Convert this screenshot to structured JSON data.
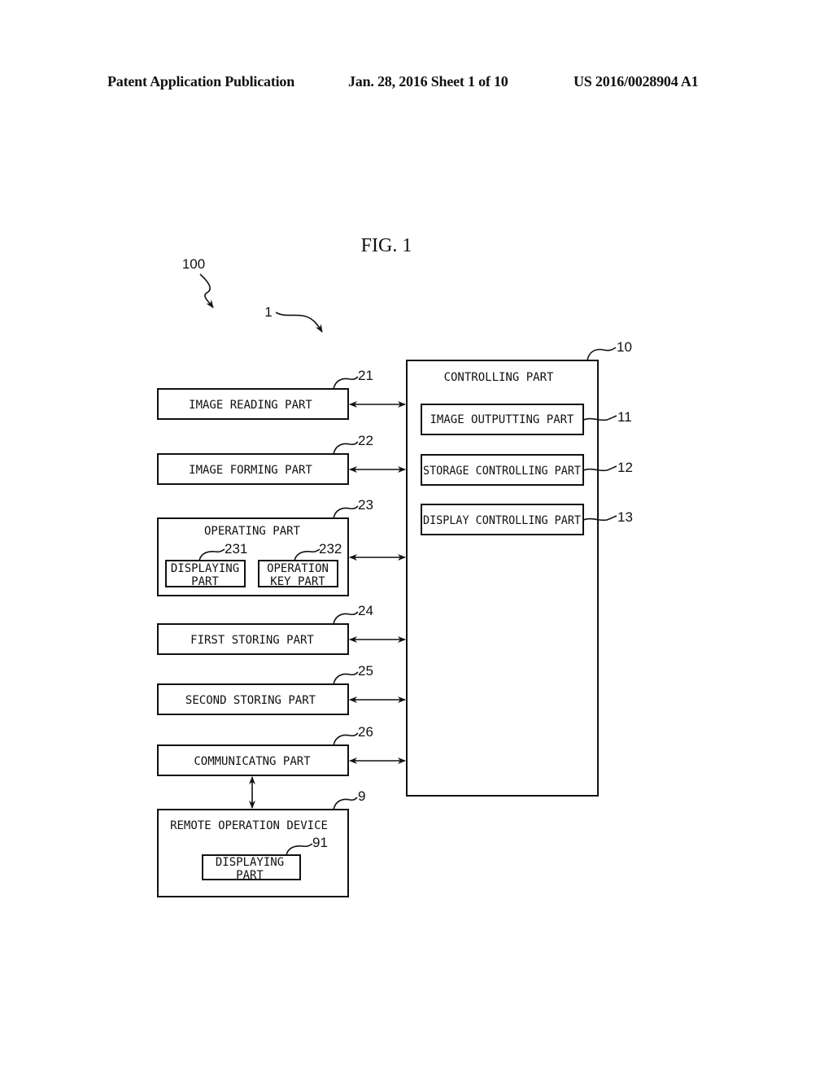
{
  "header": {
    "publication": "Patent Application Publication",
    "date_sheet": "Jan. 28, 2016  Sheet 1 of 10",
    "number": "US 2016/0028904 A1"
  },
  "figure": {
    "title": "FIG. 1",
    "system_ref": "100",
    "apparatus_ref": "1",
    "controller": {
      "ref": "10",
      "label": "CONTROLLING PART",
      "subparts": [
        {
          "ref": "11",
          "label": "IMAGE OUTPUTTING PART"
        },
        {
          "ref": "12",
          "label": "STORAGE CONTROLLING PART"
        },
        {
          "ref": "13",
          "label": "DISPLAY CONTROLLING PART"
        }
      ]
    },
    "parts": [
      {
        "ref": "21",
        "label": "IMAGE READING PART"
      },
      {
        "ref": "22",
        "label": "IMAGE FORMING PART"
      },
      {
        "ref": "23",
        "label": "OPERATING PART",
        "subparts": [
          {
            "ref": "231",
            "line1": "DISPLAYING",
            "line2": "PART"
          },
          {
            "ref": "232",
            "line1": "OPERATION",
            "line2": "KEY PART"
          }
        ]
      },
      {
        "ref": "24",
        "label": "FIRST STORING PART"
      },
      {
        "ref": "25",
        "label": "SECOND STORING PART"
      },
      {
        "ref": "26",
        "label": "COMMUNICATNG PART"
      }
    ],
    "remote": {
      "ref": "9",
      "label": "REMOTE OPERATION DEVICE",
      "sub": {
        "ref": "91",
        "line1": "DISPLAYING",
        "line2": "PART"
      }
    }
  }
}
